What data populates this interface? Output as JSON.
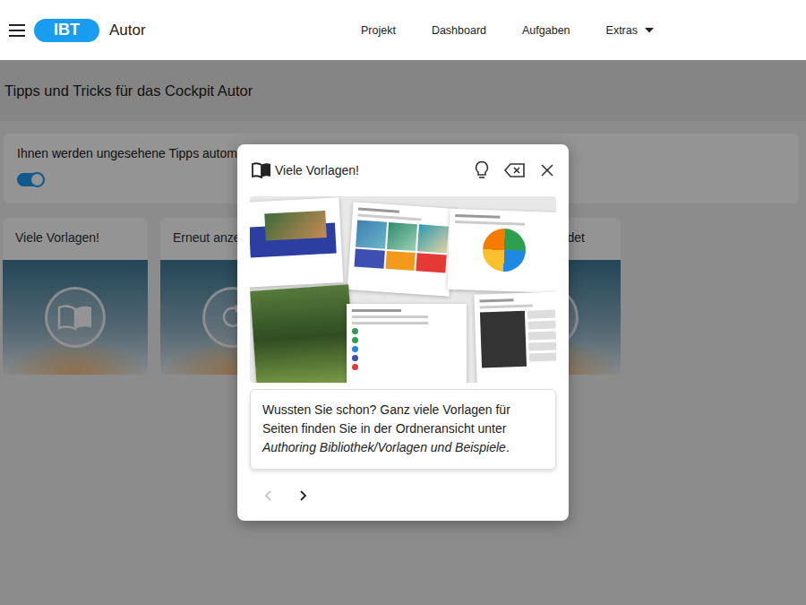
{
  "header": {
    "logo": "IBT",
    "app_name": "Autor",
    "nav": [
      {
        "label": "Projekt",
        "dropdown": false
      },
      {
        "label": "Dashboard",
        "dropdown": false
      },
      {
        "label": "Aufgaben",
        "dropdown": false
      },
      {
        "label": "Extras",
        "dropdown": true
      }
    ]
  },
  "page": {
    "title": "Tipps und Tricks für das Cockpit Autor",
    "auto_show": {
      "label": "Ihnen werden ungesehene Tipps automa",
      "on": true
    },
    "tip_cards": [
      {
        "title": "Viele Vorlagen!"
      },
      {
        "title": "Erneut anze"
      },
      {
        "title": ""
      },
      {
        "title": "det"
      }
    ]
  },
  "modal": {
    "title": "Viele Vorlagen!",
    "text": {
      "intro": "Wussten Sie schon? Ganz viele Vorlagen für Seiten finden Sie in der Ordneransicht unter ",
      "emphasis": "Authoring Bibliothek/Vorlagen und Beispiele",
      "end": "."
    },
    "pager": {
      "prev_disabled": true,
      "next_disabled": false
    }
  }
}
